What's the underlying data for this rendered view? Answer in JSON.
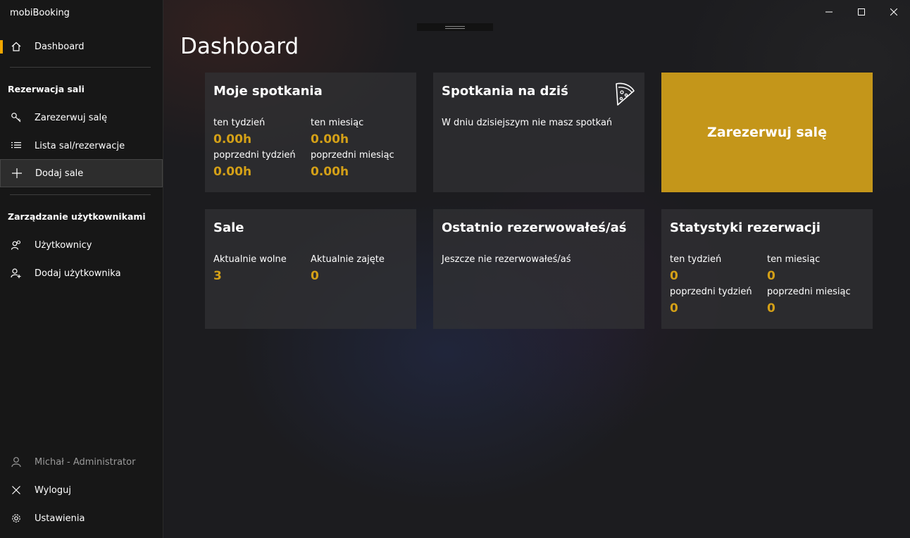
{
  "app": {
    "title": "mobiBooking"
  },
  "sidebar": {
    "dashboard": "Dashboard",
    "section_rooms": "Rezerwacja sali",
    "book_room": "Zarezerwuj salę",
    "room_list": "Lista sal/rezerwacje",
    "add_room": "Dodaj sale",
    "section_users": "Zarządzanie użytkownikami",
    "users": "Użytkownicy",
    "add_user": "Dodaj użytkownika",
    "current_user": "Michał - Administrator",
    "logout": "Wyloguj",
    "settings": "Ustawienia"
  },
  "page": {
    "title": "Dashboard"
  },
  "cards": {
    "my_meetings": {
      "title": "Moje spotkania",
      "this_week_label": "ten tydzień",
      "this_week_value": "0.00h",
      "this_month_label": "ten miesiąc",
      "this_month_value": "0.00h",
      "prev_week_label": "poprzedni tydzień",
      "prev_week_value": "0.00h",
      "prev_month_label": "poprzedni miesiąc",
      "prev_month_value": "0.00h"
    },
    "today": {
      "title": "Spotkania na dziś",
      "text": "W dniu dzisiejszym nie masz spotkań",
      "icon": "pizza-icon"
    },
    "book_cta": {
      "label": "Zarezerwuj salę"
    },
    "rooms": {
      "title": "Sale",
      "free_label": "Aktualnie wolne",
      "free_value": "3",
      "busy_label": "Aktualnie zajęte",
      "busy_value": "0"
    },
    "recent": {
      "title": "Ostatnio rezerwowałeś/aś",
      "text": "Jeszcze nie rezerwowałeś/aś"
    },
    "stats": {
      "title": "Statystyki rezerwacji",
      "this_week_label": "ten tydzień",
      "this_week_value": "0",
      "this_month_label": "ten miesiąc",
      "this_month_value": "0",
      "prev_week_label": "poprzedni tydzień",
      "prev_week_value": "0",
      "prev_month_label": "poprzedni miesiąc",
      "prev_month_value": "0"
    }
  },
  "colors": {
    "accent": "#f2a700",
    "value": "#d4a017",
    "cta_bg": "#c4961a"
  }
}
